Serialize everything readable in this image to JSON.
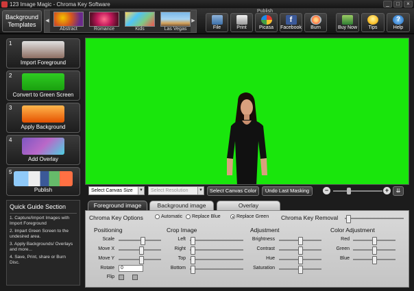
{
  "window": {
    "title": "123 Image Magic - Chroma Key Software"
  },
  "toolbar": {
    "bg_templates_line1": "Background",
    "bg_templates_line2": "Templates",
    "templates": [
      "Abstract",
      "Romance",
      "Kids",
      "Las Vegas"
    ],
    "publish_label": "Publish",
    "publish_buttons": [
      "File",
      "Print",
      "Picasa",
      "Facebook",
      "Burn"
    ],
    "right_buttons": [
      "Buy Now",
      "Tips",
      "Help"
    ]
  },
  "steps": [
    {
      "num": "1",
      "label": "Import Foreground"
    },
    {
      "num": "2",
      "label": "Convert to Green Screen"
    },
    {
      "num": "3",
      "label": "Apply Background"
    },
    {
      "num": "4",
      "label": "Add Overlay"
    },
    {
      "num": "5",
      "label": "Publish"
    }
  ],
  "guide": {
    "title": "Quick Guide Section",
    "items": [
      "1. Capture/Import Images with Import Foreground",
      "2. Impart Green Screen to the undesired area.",
      "3. Apply Backgrounds/ Overlays and more...",
      "4. Save, Print, share or Burn Disc."
    ]
  },
  "canvas_controls": {
    "canvas_size": "Select Canvas Size",
    "resolution": "Select Resolution",
    "canvas_color_btn": "Select Canvas Color",
    "undo_btn": "Undo Last Masking",
    "zoom_level": 0.3
  },
  "tabs": [
    "Foreground image",
    "Background image",
    "Overlay"
  ],
  "panel": {
    "chroma_options_label": "Chroma Key Options",
    "chroma_options": [
      "Automatic",
      "Replace Blue",
      "Replace Green"
    ],
    "chroma_selected": "Replace Green",
    "chroma_removal_label": "Chroma Key Removal",
    "positioning": {
      "title": "Positioning",
      "labels": [
        "Scale",
        "Move X",
        "Move Y",
        "Rotate",
        "Flip"
      ],
      "rotate_value": "0"
    },
    "crop": {
      "title": "Crop Image",
      "labels": [
        "Left",
        "Right",
        "Top",
        "Bottom"
      ]
    },
    "adjustment": {
      "title": "Adjustment",
      "labels": [
        "Brightness",
        "Contrast",
        "Hue",
        "Saturation"
      ]
    },
    "color_adjustment": {
      "title": "Color Adjustment",
      "labels": [
        "Red",
        "Green",
        "Blue"
      ]
    }
  },
  "colors": {
    "green_screen": "#19e60c",
    "panel_bg": "#d0d0d0",
    "toolbar_bg": "#222222"
  },
  "icons": {
    "publish": [
      "floppy-icon",
      "printer-icon",
      "picasa-icon",
      "facebook-icon",
      "burn-disc-icon"
    ],
    "right": [
      "cart-icon",
      "lightbulb-icon",
      "help-icon"
    ]
  }
}
